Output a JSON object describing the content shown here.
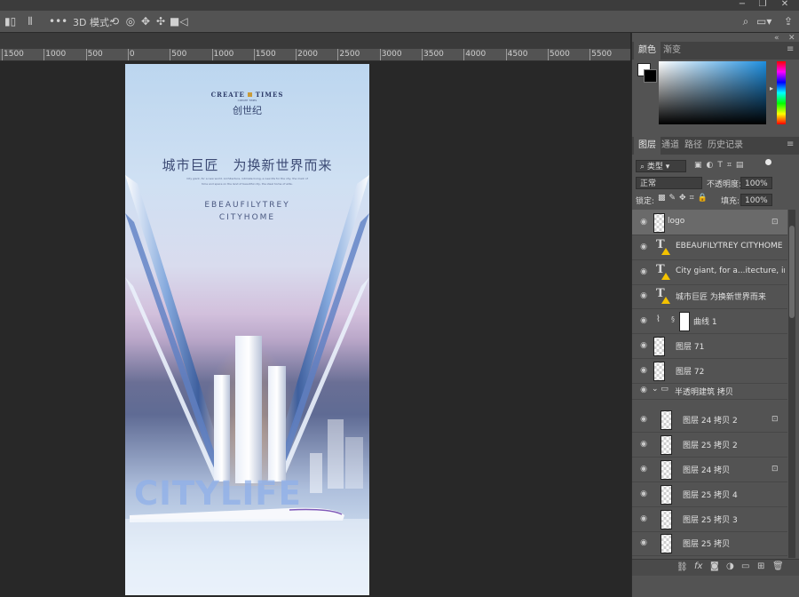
{
  "options_bar": {
    "mode_label": "3D 模式:",
    "icons": [
      "align-left-icon",
      "distribute-icon",
      "more-icon",
      "orbit-3d-icon",
      "roll-3d-icon",
      "drag-3d-icon",
      "slide-3d-icon",
      "camera-3d-icon"
    ],
    "right_icons": [
      "search-icon",
      "workspace-icon",
      "share-icon"
    ]
  },
  "window_controls": [
    "minimize",
    "restore",
    "close"
  ],
  "ruler": {
    "labels": [
      "1500",
      "1000",
      "500",
      "0",
      "500",
      "1000",
      "1500",
      "2000",
      "2500",
      "3000",
      "3500",
      "4000",
      "4500",
      "5000",
      "5500"
    ]
  },
  "poster": {
    "logo_title": "CREATE",
    "logo_title_2": "TIMES",
    "logo_sub": "CREATE TIMES",
    "logo_cn": "创世纪",
    "headline": "城市巨匠　为换新世界而来",
    "small_copy_1": "City giant, for a new world. Architecture, intimate living, a new life for the city, the mark of",
    "small_copy_2": "time and space on the land of beautiful city, the ideal home of elite.",
    "slogan_1": "EBEAUFILYTREY",
    "slogan_2": "CITYHOME",
    "watermark": "CITYLIFE"
  },
  "panel": {
    "color_tabs": [
      "颜色",
      "渐变"
    ],
    "layer_tabs": [
      "图层",
      "通道",
      "路径",
      "历史记录"
    ],
    "filter_kind": "类型",
    "blend_mode": "正常",
    "opacity_label": "不透明度:",
    "opacity_value": "100%",
    "lock_label": "锁定:",
    "fill_label": "填充:",
    "fill_value": "100%",
    "layers": [
      {
        "name": "logo",
        "type": "smart",
        "locked": true,
        "selected": true
      },
      {
        "name": "EBEAUFILYTREY  CITYHOME",
        "type": "text"
      },
      {
        "name": "City giant, for a...itecture, intimat",
        "type": "text"
      },
      {
        "name": "城市巨匠  为换新世界而来",
        "type": "text"
      },
      {
        "name": "曲线 1",
        "type": "adjustment"
      },
      {
        "name": "图层 71",
        "type": "pixel"
      },
      {
        "name": "图层 72",
        "type": "pixel"
      },
      {
        "name": "半透明建筑 拷贝",
        "type": "group"
      },
      {
        "name": "图层 24 拷贝 2",
        "type": "pixel",
        "locked": true,
        "indent": true
      },
      {
        "name": "图层 25 拷贝 2",
        "type": "pixel",
        "indent": true
      },
      {
        "name": "图层 24 拷贝",
        "type": "pixel",
        "locked": true,
        "indent": true
      },
      {
        "name": "图层 25 拷贝 4",
        "type": "pixel",
        "indent": true
      },
      {
        "name": "图层 25 拷贝 3",
        "type": "pixel",
        "indent": true
      },
      {
        "name": "图层 25 拷贝",
        "type": "pixel",
        "indent": true
      },
      {
        "name": "图层 70",
        "type": "pixel",
        "indent": true
      }
    ],
    "bottom_icons": [
      "link-icon",
      "fx-icon",
      "mask-icon",
      "adjustment-icon",
      "folder-icon",
      "new-layer-icon",
      "trash-icon"
    ]
  },
  "colors": {
    "ps_dark": "#282828",
    "ps_panel": "#535353",
    "warn_yellow": "#f3c200"
  }
}
